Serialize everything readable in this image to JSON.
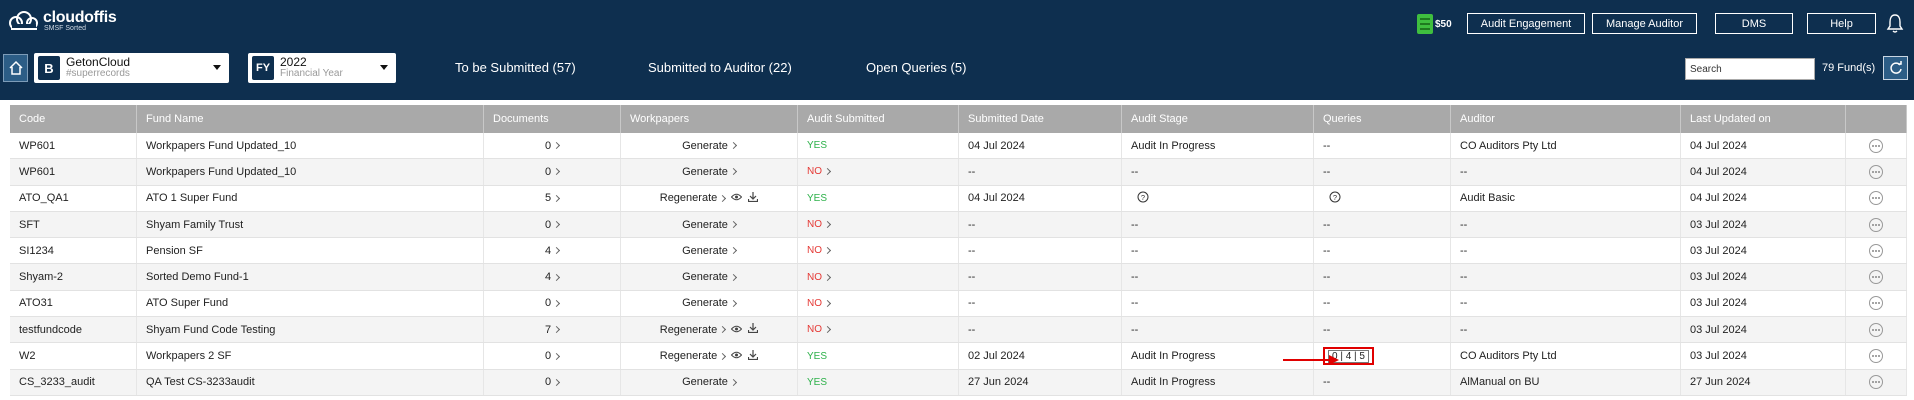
{
  "brand": {
    "name": "cloudoffis",
    "tagline": "SMSF Sorted"
  },
  "header": {
    "credit": "$50",
    "buttons": [
      "Audit Engagement",
      "Manage Auditor",
      "DMS",
      "Help"
    ]
  },
  "subbar": {
    "business": {
      "badge": "B",
      "name": "GetonCloud",
      "handle": "#superrecords"
    },
    "year": {
      "badge": "FY",
      "value": "2022",
      "label": "Financial Year"
    },
    "tabs": [
      "To be Submitted (57)",
      "Submitted to Auditor (22)",
      "Open Queries (5)"
    ],
    "search_placeholder": "Search",
    "fund_count": "79 Fund(s)"
  },
  "table": {
    "columns": [
      "Code",
      "Fund Name",
      "Documents",
      "Workpapers",
      "Audit Submitted",
      "Submitted Date",
      "Audit Stage",
      "Queries",
      "Auditor",
      "Last Updated on",
      ""
    ],
    "rows": [
      {
        "code": "WP601",
        "fund": "Workpapers Fund Updated_10",
        "docs": "0",
        "wp": "Generate",
        "wp_icons": false,
        "submitted": "YES",
        "date": "04 Jul 2024",
        "stage": "Audit In Progress",
        "queries": "--",
        "auditor": "CO Auditors Pty Ltd",
        "updated": "04 Jul 2024"
      },
      {
        "code": "WP601",
        "fund": "Workpapers Fund Updated_10",
        "docs": "0",
        "wp": "Generate",
        "wp_icons": false,
        "submitted": "NO",
        "date": "--",
        "stage": "--",
        "queries": "--",
        "auditor": "--",
        "updated": "04 Jul 2024"
      },
      {
        "code": "ATO_QA1",
        "fund": "ATO 1 Super Fund",
        "docs": "5",
        "wp": "Regenerate",
        "wp_icons": true,
        "submitted": "YES",
        "date": "04 Jul 2024",
        "stage": "help-icon",
        "queries": "help-icon",
        "auditor": "Audit Basic",
        "updated": "04 Jul 2024"
      },
      {
        "code": "SFT",
        "fund": "Shyam Family Trust",
        "docs": "0",
        "wp": "Generate",
        "wp_icons": false,
        "submitted": "NO",
        "date": "--",
        "stage": "--",
        "queries": "--",
        "auditor": "--",
        "updated": "03 Jul 2024"
      },
      {
        "code": "SI1234",
        "fund": "Pension SF",
        "docs": "4",
        "wp": "Generate",
        "wp_icons": false,
        "submitted": "NO",
        "date": "--",
        "stage": "--",
        "queries": "--",
        "auditor": "--",
        "updated": "03 Jul 2024"
      },
      {
        "code": "Shyam-2",
        "fund": "Sorted Demo Fund-1",
        "docs": "4",
        "wp": "Generate",
        "wp_icons": false,
        "submitted": "NO",
        "date": "--",
        "stage": "--",
        "queries": "--",
        "auditor": "--",
        "updated": "03 Jul 2024"
      },
      {
        "code": "ATO31",
        "fund": "ATO Super Fund",
        "docs": "0",
        "wp": "Generate",
        "wp_icons": false,
        "submitted": "NO",
        "date": "--",
        "stage": "--",
        "queries": "--",
        "auditor": "--",
        "updated": "03 Jul 2024"
      },
      {
        "code": "testfundcode",
        "fund": "Shyam Fund Code Testing",
        "docs": "7",
        "wp": "Regenerate",
        "wp_icons": true,
        "submitted": "NO",
        "date": "--",
        "stage": "--",
        "queries": "--",
        "auditor": "--",
        "updated": "03 Jul 2024"
      },
      {
        "code": "W2",
        "fund": "Workpapers 2 SF",
        "docs": "0",
        "wp": "Regenerate",
        "wp_icons": true,
        "submitted": "YES",
        "date": "02 Jul 2024",
        "stage": "Audit In Progress",
        "queries": "0 | 4 | 5",
        "auditor": "CO Auditors Pty Ltd",
        "updated": "03 Jul 2024"
      },
      {
        "code": "CS_3233_audit",
        "fund": "QA Test CS-3233audit",
        "docs": "0",
        "wp": "Generate",
        "wp_icons": false,
        "submitted": "YES",
        "date": "27 Jun 2024",
        "stage": "Audit In Progress",
        "queries": "--",
        "auditor": "AlManual on BU",
        "updated": "27 Jun 2024"
      }
    ]
  }
}
